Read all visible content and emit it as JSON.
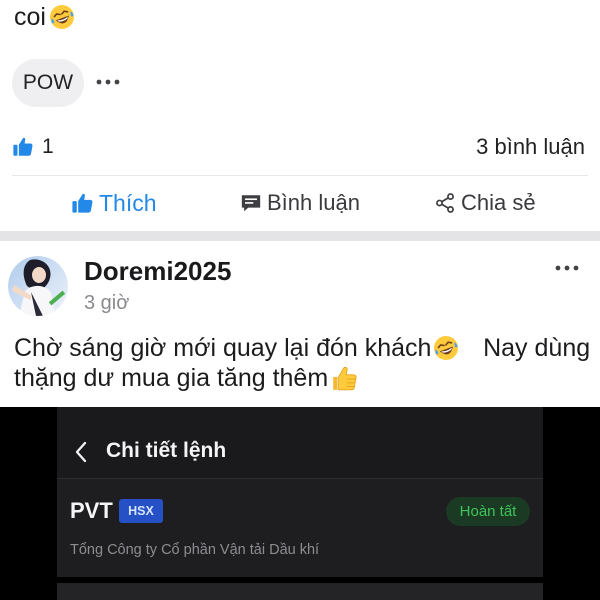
{
  "colors": {
    "accent_blue": "#2389e8",
    "text_primary": "#1c1c1e",
    "text_secondary": "#8a8a8e",
    "feed_separator": "#e4e4e6",
    "status_success": "#3ec45a",
    "exchange_badge": "#2650c6"
  },
  "post_top": {
    "text_tail": "coi",
    "text_tail_emoji": "rolling-on-the-floor-laughing",
    "tag": "POW",
    "more_icon": "more-horizontal-icon",
    "reactions": {
      "icon": "thumbs-up-icon",
      "count": "1"
    },
    "comments_count": "3 bình luận",
    "actions": [
      {
        "icon": "thumbs-up-icon",
        "label": "Thích",
        "liked": true
      },
      {
        "icon": "comment-icon",
        "label": "Bình luận"
      },
      {
        "icon": "share-icon",
        "label": "Chia sẻ"
      }
    ]
  },
  "post": {
    "author": "Doremi2025",
    "time": "3 giờ",
    "avatar": "avatar-image",
    "more_icon": "more-horizontal-icon",
    "body_segments": [
      {
        "type": "text",
        "value": "Chờ sáng giờ mới quay lại đón khách"
      },
      {
        "type": "emoji",
        "value": "rolling-on-the-floor-laughing"
      },
      {
        "type": "text",
        "value": " Nay dùng"
      },
      {
        "type": "text",
        "value": "thặng dư mua gia tăng thêm"
      },
      {
        "type": "emoji",
        "value": "thumbs-up"
      }
    ],
    "attachment": {
      "back_icon": "chevron-left-icon",
      "screen_title": "Chi tiết lệnh",
      "symbol": "PVT",
      "exchange": "HSX",
      "status": "Hoàn tất",
      "company_name": "Tổng Công ty Cổ phần Vận tải Dầu khí"
    }
  }
}
